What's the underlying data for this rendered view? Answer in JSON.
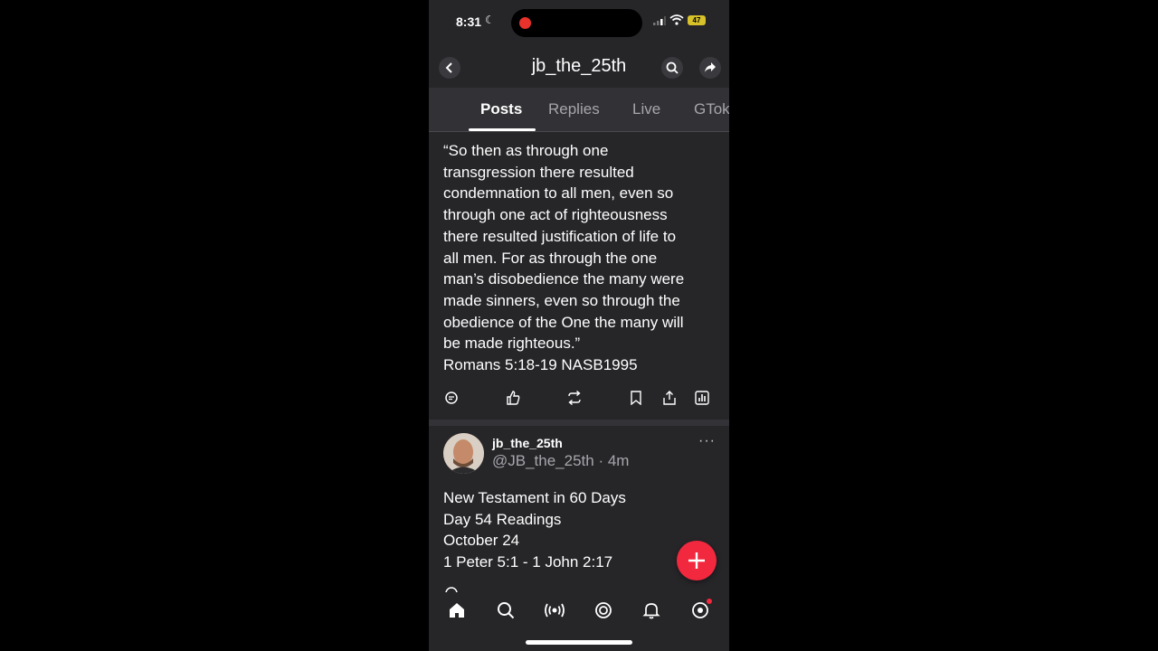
{
  "status_bar": {
    "time": "8:31",
    "battery": "47"
  },
  "header": {
    "title": "jb_the_25th",
    "icons": [
      "back-icon",
      "search-icon",
      "share-icon"
    ]
  },
  "tabs": [
    {
      "label": "Posts",
      "active": true
    },
    {
      "label": "Replies",
      "active": false
    },
    {
      "label": "Live",
      "active": false
    },
    {
      "label": "GTok",
      "active": false
    }
  ],
  "posts": [
    {
      "text": "“So then as through one\ntransgression there resulted\ncondemnation to all men, even so\nthrough one act of righteousness\nthere resulted justification of life to\nall men. For as through the one\nman’s disobedience the many were\nmade sinners, even so through the\nobedience of the One the many will\nbe made righteous.”\nRomans 5:18-19 NASB1995",
      "actions": [
        "comment-icon",
        "like-icon",
        "repost-icon",
        "bookmark-icon",
        "share-icon",
        "stats-icon"
      ]
    },
    {
      "display_name": "jb_the_25th",
      "handle_time": "@JB_the_25th · 4m",
      "more": "···",
      "text": "New Testament in 60 Days\nDay 54 Readings\nOctober 24\n1 Peter 5:1 - 1 John 2:17"
    }
  ],
  "bottom_nav": [
    "home-icon",
    "search-icon",
    "live-icon",
    "gtok-icon",
    "notifications-icon",
    "profile-icon"
  ],
  "colors": {
    "background": "#262528",
    "accent": "#f2283f",
    "muted_text": "#a7a6ab"
  }
}
